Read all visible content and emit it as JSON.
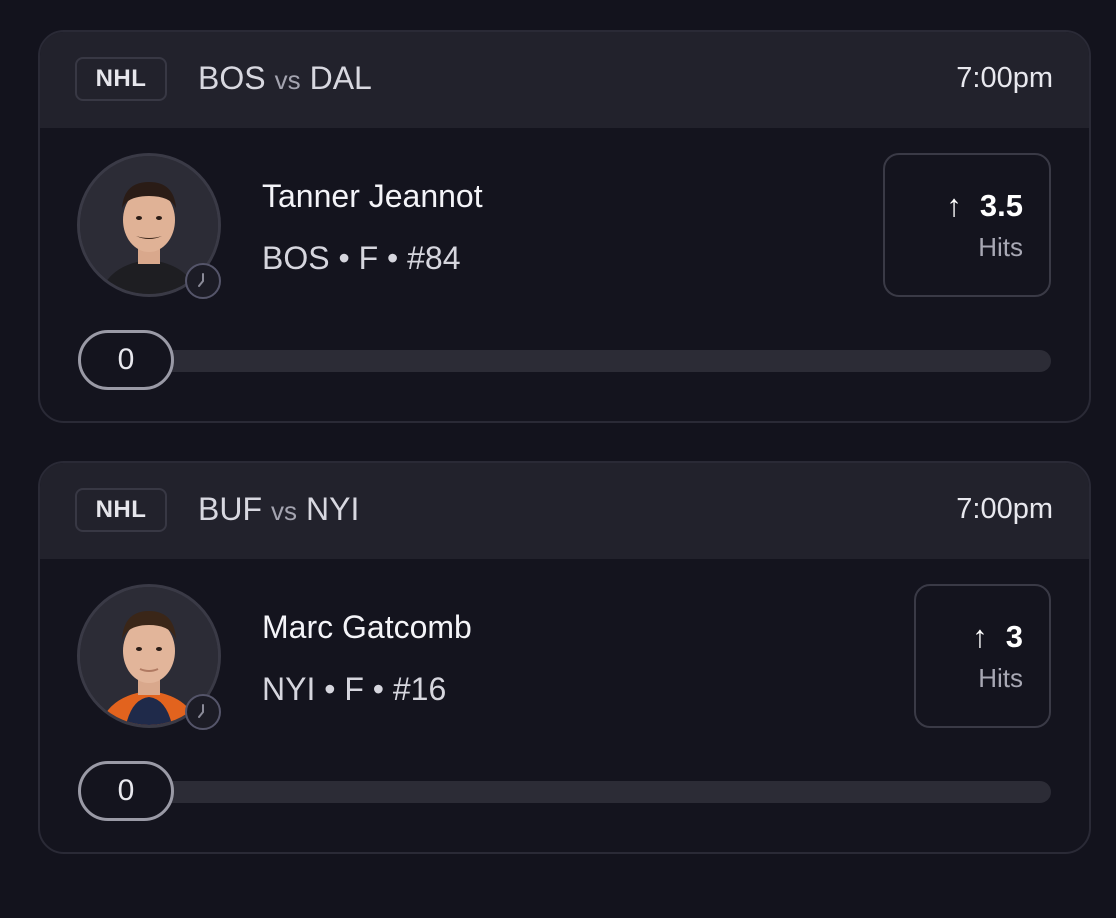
{
  "cards": [
    {
      "league": "NHL",
      "home_team": "BOS",
      "vs_label": "vs",
      "away_team": "DAL",
      "time": "7:00pm",
      "player": {
        "name": "Tanner Jeannot",
        "team": "BOS",
        "position": "F",
        "number": "#84",
        "meta": "BOS • F • #84",
        "jersey_color": "#1e1e22"
      },
      "line": {
        "direction_icon": "arrow-up-icon",
        "direction": "↑",
        "value": "3.5",
        "stat": "Hits"
      },
      "progress": {
        "current": "0",
        "fraction": 0
      }
    },
    {
      "league": "NHL",
      "home_team": "BUF",
      "vs_label": "vs",
      "away_team": "NYI",
      "time": "7:00pm",
      "player": {
        "name": "Marc Gatcomb",
        "team": "NYI",
        "position": "F",
        "number": "#16",
        "meta": "NYI • F • #16",
        "jersey_color": "#e2631e"
      },
      "line": {
        "direction_icon": "arrow-up-icon",
        "direction": "↑",
        "value": "3",
        "stat": "Hits"
      },
      "progress": {
        "current": "0",
        "fraction": 0
      }
    }
  ]
}
